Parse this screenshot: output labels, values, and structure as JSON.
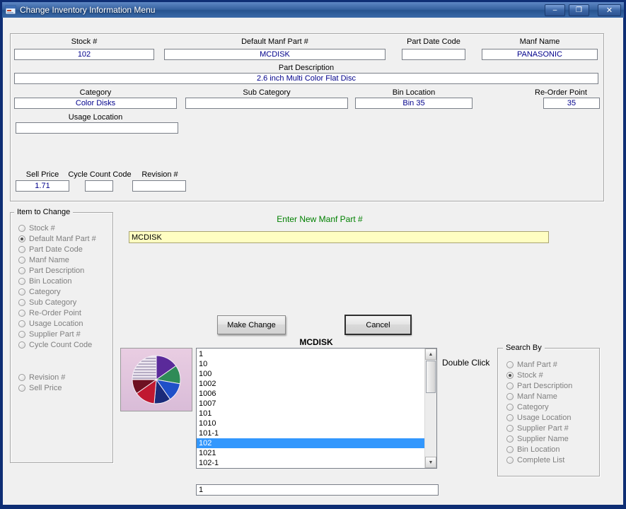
{
  "window": {
    "title": "Change Inventory Information Menu",
    "icons": {
      "minimize": "–",
      "maximize": "❐",
      "close": "✕"
    }
  },
  "info": {
    "stock": {
      "label": "Stock #",
      "value": "102"
    },
    "default_manf_part": {
      "label": "Default Manf Part #",
      "value": "MCDISK"
    },
    "part_date_code": {
      "label": "Part Date Code",
      "value": ""
    },
    "manf_name": {
      "label": "Manf Name",
      "value": "PANASONIC"
    },
    "part_description": {
      "label": "Part Description",
      "value": "2.6 inch Multi Color Flat Disc"
    },
    "category": {
      "label": "Category",
      "value": "Color Disks"
    },
    "sub_category": {
      "label": "Sub Category",
      "value": ""
    },
    "bin_location": {
      "label": "Bin Location",
      "value": "Bin 35"
    },
    "reorder_point": {
      "label": "Re-Order Point",
      "value": "35"
    },
    "usage_location": {
      "label": "Usage Location",
      "value": ""
    },
    "sell_price": {
      "label": "Sell Price",
      "value": "1.71"
    },
    "cycle_count_code": {
      "label": "Cycle Count Code",
      "value": ""
    },
    "revision": {
      "label": "Revision #",
      "value": ""
    }
  },
  "item_to_change": {
    "title": "Item to Change",
    "options": [
      {
        "label": "Stock #",
        "selected": false
      },
      {
        "label": "Default Manf Part #",
        "selected": true
      },
      {
        "label": "Part Date Code",
        "selected": false
      },
      {
        "label": "Manf Name",
        "selected": false
      },
      {
        "label": "Part Description",
        "selected": false
      },
      {
        "label": "Bin Location",
        "selected": false
      },
      {
        "label": "Category",
        "selected": false
      },
      {
        "label": "Sub Category",
        "selected": false
      },
      {
        "label": "Re-Order Point",
        "selected": false
      },
      {
        "label": "Usage Location",
        "selected": false
      },
      {
        "label": "Supplier Part #",
        "selected": false
      },
      {
        "label": "Cycle Count Code",
        "selected": false
      }
    ],
    "options_extra": [
      {
        "label": "Revision #",
        "selected": false
      },
      {
        "label": "Sell Price",
        "selected": false
      }
    ]
  },
  "change_area": {
    "prompt": "Enter New Manf Part #",
    "new_value": "MCDISK",
    "make_change_label": "Make Change",
    "cancel_label": "Cancel",
    "selected_part_heading": "MCDISK"
  },
  "stock_list": {
    "double_click_label": "Double Click",
    "items": [
      {
        "text": "1",
        "selected": false
      },
      {
        "text": "10",
        "selected": false
      },
      {
        "text": "100",
        "selected": false
      },
      {
        "text": "1002",
        "selected": false
      },
      {
        "text": "1006",
        "selected": false
      },
      {
        "text": "1007",
        "selected": false
      },
      {
        "text": "101",
        "selected": false
      },
      {
        "text": "1010",
        "selected": false
      },
      {
        "text": "101-1",
        "selected": false
      },
      {
        "text": "102",
        "selected": true
      },
      {
        "text": "1021",
        "selected": false
      },
      {
        "text": "102-1",
        "selected": false
      }
    ],
    "footer_value": "1"
  },
  "search_by": {
    "title": "Search By",
    "options": [
      {
        "label": "Manf Part #",
        "selected": false
      },
      {
        "label": "Stock #",
        "selected": true
      },
      {
        "label": "Part Description",
        "selected": false
      },
      {
        "label": "Manf Name",
        "selected": false
      },
      {
        "label": "Category",
        "selected": false
      },
      {
        "label": "Usage Location",
        "selected": false
      },
      {
        "label": "Supplier Part #",
        "selected": false
      },
      {
        "label": "Supplier Name",
        "selected": false
      },
      {
        "label": "Bin Location",
        "selected": false
      },
      {
        "label": "Complete List",
        "selected": false
      }
    ]
  },
  "scrollbar": {
    "up": "▲",
    "down": "▼"
  },
  "colors": {
    "value_text": "#00008B",
    "prompt_green": "#008000",
    "input_yellow": "#FFFEC2",
    "selection_blue": "#3297FD",
    "titlebar_blue": "#35619F"
  }
}
